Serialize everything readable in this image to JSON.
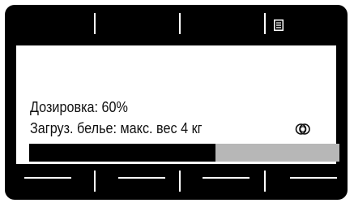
{
  "display": {
    "dosage_text": "Дозировка: 60%",
    "load_text": "Загруз. белье: макс. вес 4 кг",
    "progress_percent": 60,
    "colors": {
      "frame": "#000000",
      "screen": "#ffffff",
      "progress_fill": "#000000",
      "progress_track": "#b7b7b7"
    }
  },
  "softkeys": {
    "top": [
      "",
      "",
      "",
      "menu-icon"
    ],
    "bottom": [
      "dash",
      "dash",
      "dash",
      "dash"
    ]
  },
  "icons": {
    "menu": "menu-list-icon",
    "status": "rings-icon"
  }
}
